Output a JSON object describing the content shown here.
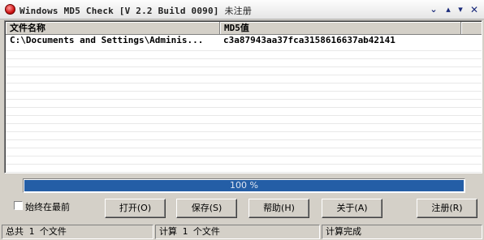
{
  "window": {
    "title": "Windows MD5 Check [V 2.2 Build 0090]",
    "title_suffix": "未注册",
    "controls": {
      "minimize": "⌄",
      "up": "▴",
      "down": "▾",
      "close": "✕"
    }
  },
  "list": {
    "columns": [
      "文件名称",
      "MD5值",
      ""
    ],
    "rows": [
      {
        "file": "C:\\Documents and Settings\\Adminis...",
        "md5": "c3a87943aa37fca3158616637ab42141"
      }
    ]
  },
  "progress": {
    "text": "100 %",
    "value": 100
  },
  "checkbox": {
    "label": "始终在最前",
    "checked": false
  },
  "buttons": {
    "open": "打开(O)",
    "save": "保存(S)",
    "help": "帮助(H)",
    "about": "关于(A)",
    "register": "注册(R)"
  },
  "status": {
    "total": "总共 1 个文件",
    "computed": "计算 1 个文件",
    "state": "计算完成"
  },
  "colors": {
    "progress_fill": "#245ea6",
    "face": "#d4d0c8"
  }
}
